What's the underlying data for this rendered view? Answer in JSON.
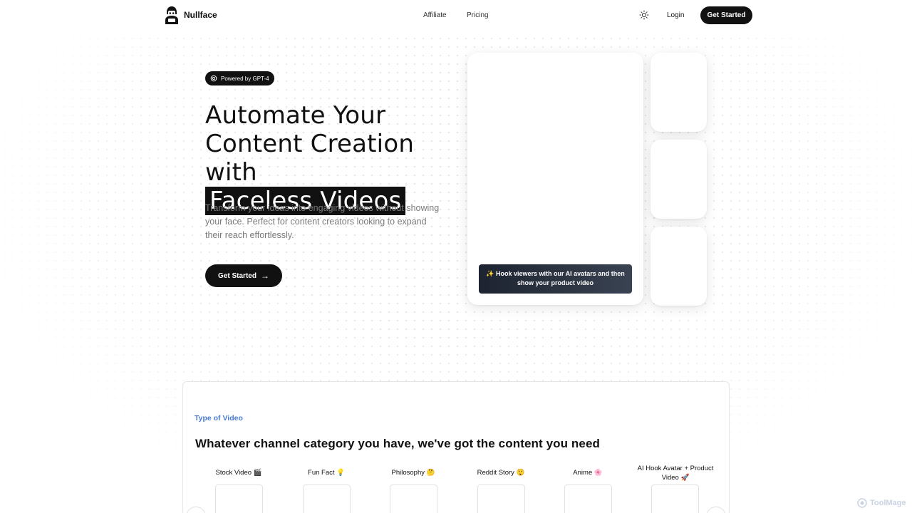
{
  "header": {
    "brand": "Nullface",
    "nav": [
      "Affiliate",
      "Pricing"
    ],
    "login": "Login",
    "cta": "Get Started"
  },
  "hero": {
    "badge": "Powered by GPT-4",
    "title_line1": "Automate Your",
    "title_line2": "Content Creation with",
    "title_highlight": "Faceless Videos",
    "subtitle": "Transform your ideas into engaging videos without showing your face. Perfect for content creators looking to expand their reach effortlessly.",
    "cta": "Get Started",
    "cta_arrow": "→"
  },
  "preview": {
    "caption": "✨ Hook viewers with our AI avatars and then show your product video"
  },
  "section": {
    "label": "Type of Video",
    "title": "Whatever channel category you have, we've got the content you need",
    "categories": [
      "Stock Video 🎬",
      "Fun Fact 💡",
      "Philosophy 🤔",
      "Reddit Story 😲",
      "Anime 🌸",
      "AI Hook Avatar + Product Video 🚀"
    ]
  },
  "watermark": "ToolMage",
  "icons": {
    "logo": "masked-figure-logo",
    "badge": "openai-icon",
    "theme": "sun-icon",
    "arrows": [
      "chevron-left-icon",
      "chevron-right-icon"
    ]
  },
  "colors": {
    "accent": "#4b7bd4",
    "dark": "#111111"
  }
}
